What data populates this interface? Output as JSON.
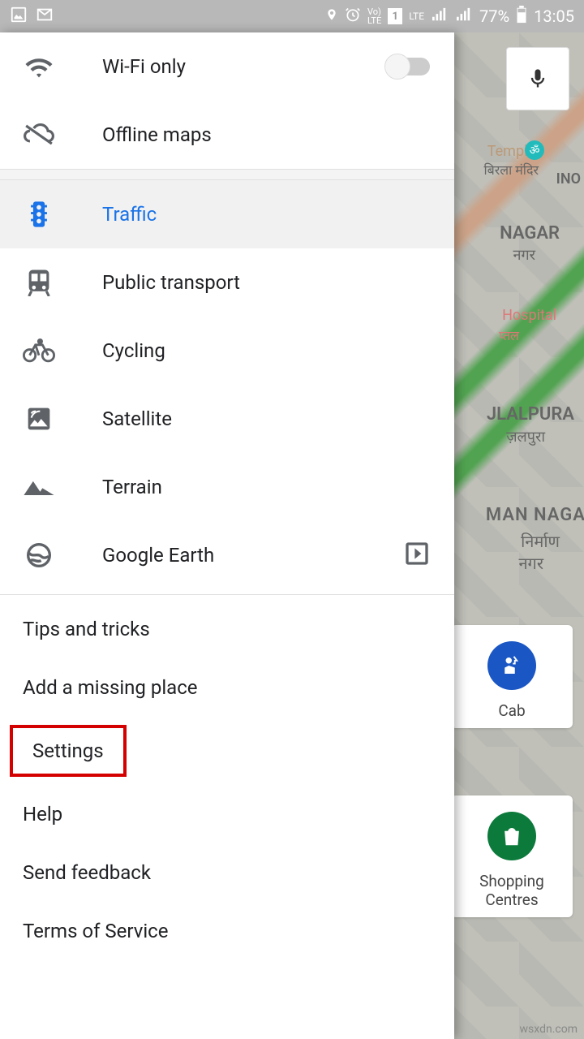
{
  "statusbar": {
    "battery": "77%",
    "time": "13:05",
    "lte": "LTE",
    "vol": "Vo)",
    "lte2": "LTE",
    "sim": "1"
  },
  "drawer": {
    "wifi_only": "Wi-Fi only",
    "offline_maps": "Offline maps",
    "traffic": "Traffic",
    "public_transport": "Public transport",
    "cycling": "Cycling",
    "satellite": "Satellite",
    "terrain": "Terrain",
    "google_earth": "Google Earth",
    "tips": "Tips and tricks",
    "add_missing": "Add a missing place",
    "settings": "Settings",
    "help": "Help",
    "feedback": "Send feedback",
    "tos": "Terms of Service"
  },
  "map": {
    "temple": "Temple",
    "temple2": "बिरला मंदिर",
    "ino": "INO",
    "nagar": "NAGAR",
    "nagar2": "नगर",
    "hospital": "Hospital",
    "hospital2": "प्तल",
    "jlalpura": "JLALPURA",
    "jlalpura2": "ज़लपुरा",
    "man_nagar": "MAN NAGA",
    "man_nagar2": "निर्माण",
    "man_nagar3": "नगर",
    "cab": "Cab",
    "shopping": "Shopping",
    "centres": "Centres"
  },
  "watermark": "wsxdn.com"
}
